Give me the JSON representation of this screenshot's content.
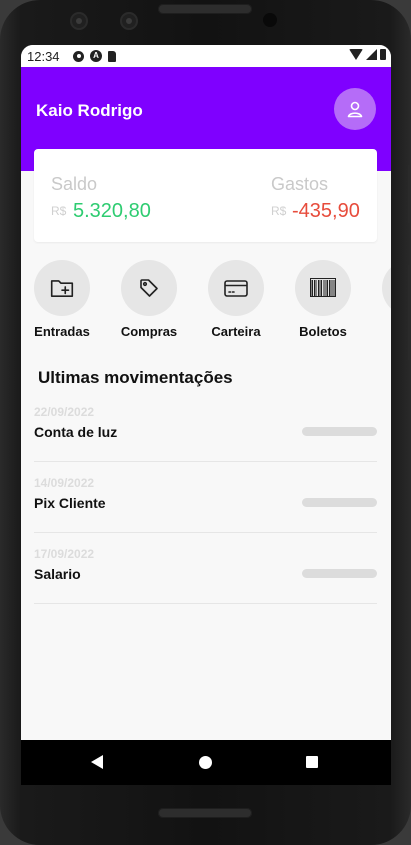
{
  "status_bar": {
    "time": "12:34",
    "icons": [
      "settings-icon",
      "a-icon",
      "sd-card-icon",
      "wifi-icon",
      "signal-icon",
      "battery-icon"
    ]
  },
  "header": {
    "user_name": "Kaio Rodrigo",
    "avatar_icon": "user-icon",
    "background_color": "#7f00ff"
  },
  "balance": {
    "saldo": {
      "label": "Saldo",
      "currency": "R$",
      "value": "5.320,80",
      "color": "#2ecc71"
    },
    "gastos": {
      "label": "Gastos",
      "currency": "R$",
      "value": "-435,90",
      "color": "#e74c3c"
    }
  },
  "actions": [
    {
      "label": "Entradas",
      "icon": "folder-plus-icon"
    },
    {
      "label": "Compras",
      "icon": "tag-icon"
    },
    {
      "label": "Carteira",
      "icon": "credit-card-icon"
    },
    {
      "label": "Boletos",
      "icon": "barcode-icon"
    }
  ],
  "transactions": {
    "title": "Ultimas movimentações",
    "items": [
      {
        "date": "22/09/2022",
        "name": "Conta de luz"
      },
      {
        "date": "14/09/2022",
        "name": "Pix Cliente"
      },
      {
        "date": "17/09/2022",
        "name": "Salario"
      }
    ]
  },
  "nav_bar": {
    "buttons": [
      "back-icon",
      "home-icon",
      "recents-icon"
    ]
  }
}
